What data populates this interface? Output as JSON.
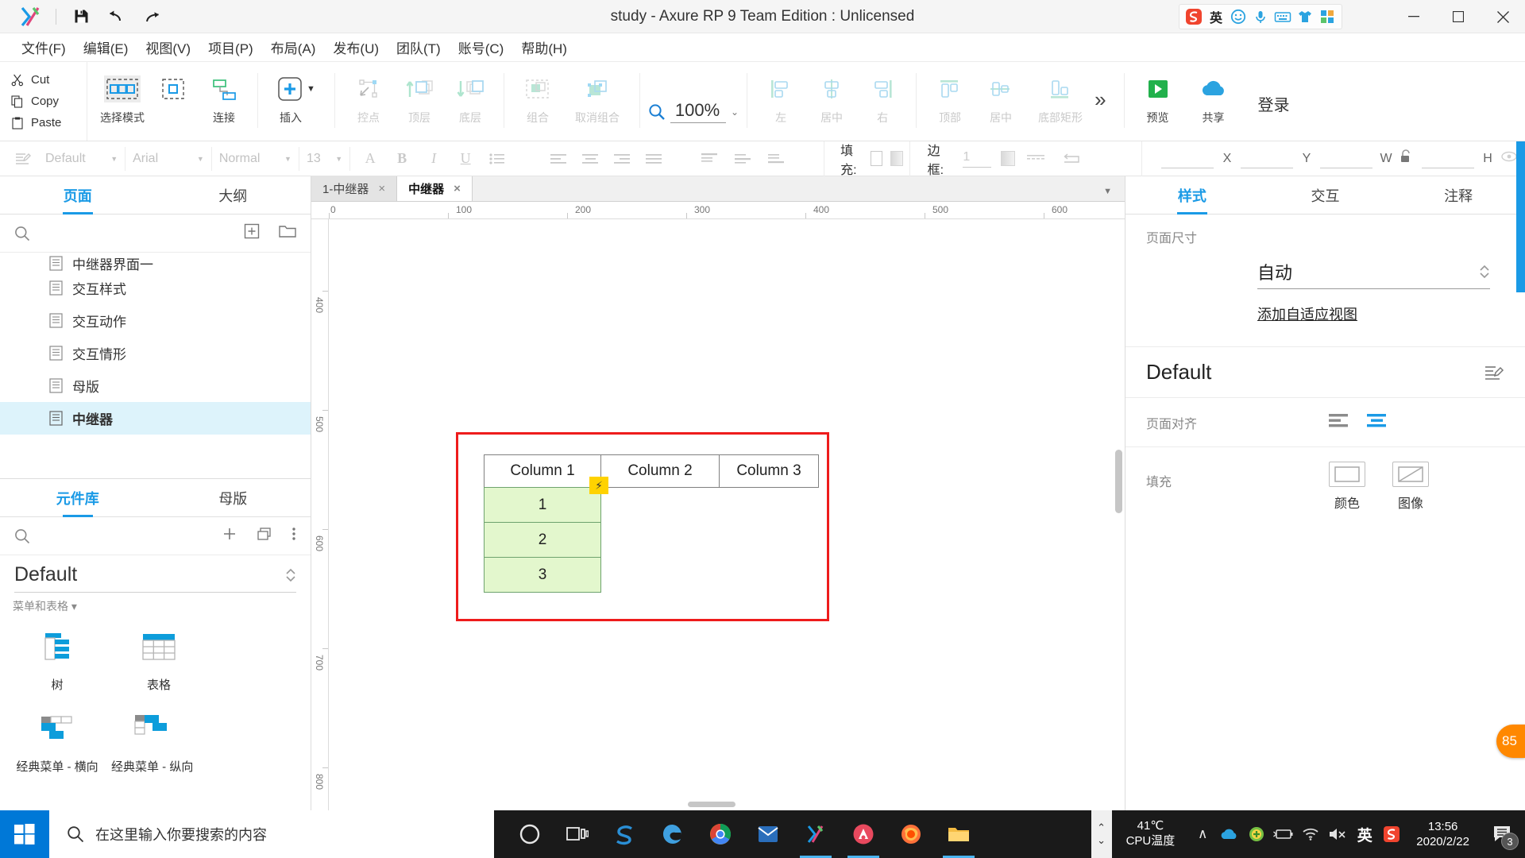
{
  "window": {
    "title": "study - Axure RP 9 Team Edition : Unlicensed",
    "minimize": "–",
    "maximize": "□",
    "close": "×",
    "save_icon": "save-icon",
    "undo_icon": "undo-icon",
    "redo_icon": "redo-icon"
  },
  "menubar": {
    "items": [
      {
        "label": "文件(F)",
        "name": "menu-file"
      },
      {
        "label": "编辑(E)",
        "name": "menu-edit"
      },
      {
        "label": "视图(V)",
        "name": "menu-view"
      },
      {
        "label": "项目(P)",
        "name": "menu-project"
      },
      {
        "label": "布局(A)",
        "name": "menu-layout"
      },
      {
        "label": "发布(U)",
        "name": "menu-publish"
      },
      {
        "label": "团队(T)",
        "name": "menu-team"
      },
      {
        "label": "账号(C)",
        "name": "menu-account"
      },
      {
        "label": "帮助(H)",
        "name": "menu-help"
      }
    ]
  },
  "clipboard": {
    "cut": "Cut",
    "copy": "Copy",
    "paste": "Paste"
  },
  "toolbar": {
    "select_mode": "选择模式",
    "connect": "连接",
    "insert": "插入",
    "point": "控点",
    "bring_front": "顶层",
    "send_back": "底层",
    "group": "组合",
    "ungroup": "取消组合",
    "zoom_value": "100%",
    "align_left": "左",
    "align_center": "居中",
    "align_right": "右",
    "align_top": "顶部",
    "align_middle": "居中",
    "align_bottom": "底部矩形",
    "more": "»",
    "preview": "预览",
    "share": "共享",
    "login": "登录"
  },
  "formatbar": {
    "style": "Default",
    "font": "Arial",
    "weight": "Normal",
    "size": "13",
    "font_color_icon": "A",
    "bold": "B",
    "italic": "I",
    "underline": "U",
    "list_icon": "list-icon",
    "fill_label": "填充:",
    "border_label": "边框:",
    "border_width": "1",
    "x_label": "X",
    "y_label": "Y",
    "w_label": "W",
    "h_label": "H"
  },
  "left_panel": {
    "tabs": [
      {
        "label": "页面",
        "active": true
      },
      {
        "label": "大纲",
        "active": false
      }
    ],
    "pages": [
      {
        "label": "中继器界面一",
        "clipped": true,
        "selected": false
      },
      {
        "label": "交互样式",
        "clipped": false,
        "selected": false
      },
      {
        "label": "交互动作",
        "clipped": false,
        "selected": false
      },
      {
        "label": "交互情形",
        "clipped": false,
        "selected": false
      },
      {
        "label": "母版",
        "clipped": false,
        "selected": false
      },
      {
        "label": "中继器",
        "clipped": false,
        "selected": true
      }
    ],
    "add_page_icon": "add-page-icon",
    "add_folder_icon": "add-folder-icon",
    "search_icon": "search-icon"
  },
  "library_panel": {
    "tabs": [
      {
        "label": "元件库",
        "active": true
      },
      {
        "label": "母版",
        "active": false
      }
    ],
    "selected_library": "Default",
    "category": "菜单和表格 ▾",
    "widgets": [
      {
        "label": "树",
        "icon": "tree-widget-icon"
      },
      {
        "label": "表格",
        "icon": "table-widget-icon"
      },
      {
        "label": "经典菜单 - 横向",
        "icon": "classic-menu-horizontal-icon"
      },
      {
        "label": "经典菜单 - 纵向",
        "icon": "classic-menu-vertical-icon"
      }
    ]
  },
  "canvas": {
    "doc_tabs": [
      {
        "label": "1-中继器",
        "active": false,
        "close": "×"
      },
      {
        "label": "中继器",
        "active": true,
        "close": "×"
      }
    ],
    "ruler_h": [
      "0",
      "100",
      "200",
      "300",
      "400",
      "500",
      "600"
    ],
    "ruler_v": [
      "400",
      "500",
      "600",
      "700",
      "800"
    ],
    "repeater": {
      "headers": [
        "Column 1",
        "Column 2",
        "Column 3"
      ],
      "rows": [
        "1",
        "2",
        "3"
      ],
      "badge_icon": "lightning-bolt-icon",
      "selection_color": "#ee1c1c",
      "row_fill": "#e3f7cd",
      "row_border": "#6ea36e"
    }
  },
  "right_panel": {
    "tabs": [
      {
        "label": "样式",
        "active": true
      },
      {
        "label": "交互",
        "active": false
      },
      {
        "label": "注释",
        "active": false
      }
    ],
    "page_size_label": "页面尺寸",
    "page_size_value": "自动",
    "add_adaptive_view": "添加自适应视图",
    "style_name": "Default",
    "style_edit_icon": "style-edit-icon",
    "page_align_label": "页面对齐",
    "fill_label": "填充",
    "fill_options": [
      {
        "label": "颜色",
        "icon": "color-fill-icon"
      },
      {
        "label": "图像",
        "icon": "image-fill-icon"
      }
    ],
    "edge_badge": "85"
  },
  "taskbar": {
    "start_icon": "windows-start-icon",
    "search_placeholder": "在这里输入你要搜索的内容",
    "search_icon": "search-icon",
    "apps": [
      {
        "name": "cortana-icon",
        "active": false
      },
      {
        "name": "task-view-icon",
        "active": false
      },
      {
        "name": "sogou-browser-icon",
        "active": false
      },
      {
        "name": "edge-icon",
        "active": false
      },
      {
        "name": "chrome-icon",
        "active": false
      },
      {
        "name": "foxmail-icon",
        "active": false
      },
      {
        "name": "axure-icon",
        "active": true
      },
      {
        "name": "design-app-icon",
        "active": true
      },
      {
        "name": "firefox-icon",
        "active": false
      },
      {
        "name": "file-explorer-icon",
        "active": true
      }
    ],
    "cpu_temp": "41℃",
    "cpu_temp_label": "CPU温度",
    "tray": [
      {
        "name": "chevron-up-icon",
        "glyph": "∧"
      },
      {
        "name": "onedrive-icon",
        "glyph": "☁"
      },
      {
        "name": "security-shield-icon",
        "glyph": "⊕"
      },
      {
        "name": "battery-icon",
        "glyph": "▭"
      },
      {
        "name": "wifi-icon",
        "glyph": "◠"
      },
      {
        "name": "volume-mute-icon",
        "glyph": "🔇"
      },
      {
        "name": "ime-english-icon",
        "glyph": "英"
      },
      {
        "name": "sogou-ime-icon",
        "glyph": "S"
      }
    ],
    "clock_time": "13:56",
    "clock_date": "2020/2/22",
    "notification_count": "3"
  }
}
